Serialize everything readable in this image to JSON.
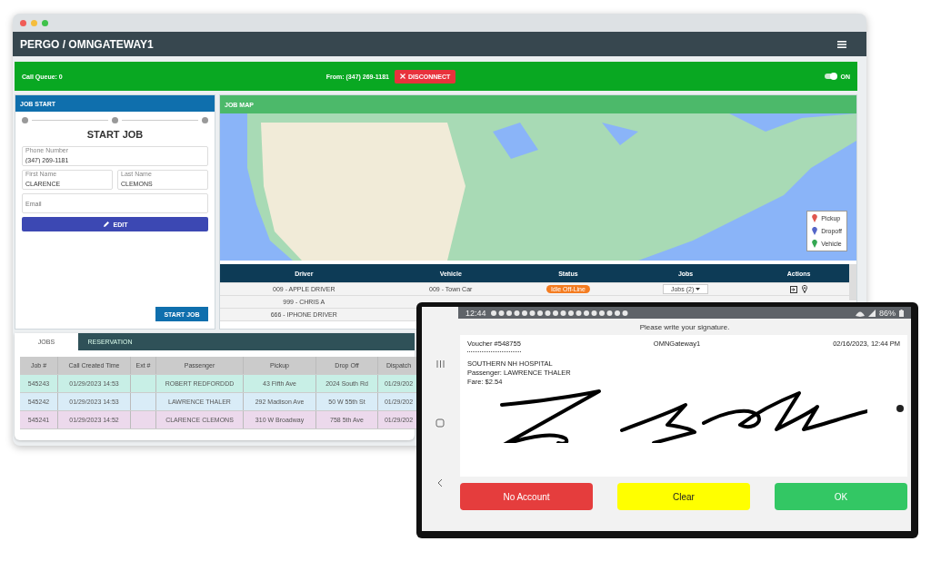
{
  "window": {
    "title": "PERGO / OMNGATEWAY1"
  },
  "call_bar": {
    "queue": "Call Queue: 0",
    "from": "From: (347) 269-1181",
    "disconnect": "DISCONNECT",
    "toggle": {
      "on": true,
      "label": "ON"
    }
  },
  "job_start": {
    "header": "JOB START",
    "title": "START JOB",
    "field_rows": [
      [
        {
          "label": "Phone Number",
          "value": "(347) 269-1181"
        }
      ],
      [
        {
          "label": "First Name",
          "value": "CLARENCE"
        },
        {
          "label": "Last Name",
          "value": "CLEMONS"
        }
      ],
      [
        {
          "placeholder": "Email"
        }
      ]
    ],
    "edit_button": "EDIT",
    "start_button": "START JOB"
  },
  "job_map": {
    "header": "JOB MAP",
    "legend": [
      {
        "label": "Pickup",
        "color": "#e0574f"
      },
      {
        "label": "Dropoff",
        "color": "#5566c8"
      },
      {
        "label": "Vehicle",
        "color": "#34a853"
      }
    ]
  },
  "drivers": {
    "columns": [
      "Driver",
      "Vehicle",
      "Status",
      "Jobs",
      "Actions"
    ],
    "rows": [
      {
        "driver": "009 - APPLE DRIVER",
        "vehicle": "009 - Town Car",
        "status": "Idle Off-Line",
        "jobs": "Jobs (2)"
      },
      {
        "driver": "999 - CHRIS A"
      },
      {
        "driver": "666 - IPHONE DRIVER"
      }
    ]
  },
  "jobs_panel": {
    "tabs": [
      {
        "label": "JOBS",
        "selected": true
      },
      {
        "label": "RESERVATION",
        "selected": false
      }
    ],
    "columns": [
      "Job #",
      "Call Created Time",
      "Ext #",
      "Passenger",
      "Pickup",
      "Drop Off",
      "Dispatch"
    ],
    "rows": [
      {
        "color": "#c8efe6",
        "cells": [
          "545243",
          "01/29/2023 14:53",
          "",
          "ROBERT REDFORDDD",
          "43 Fifth Ave",
          "2024 South Rd",
          "01/29/202"
        ]
      },
      {
        "color": "#d9ecf7",
        "cells": [
          "545242",
          "01/29/2023 14:53",
          "",
          "LAWRENCE THALER",
          "292 Madison Ave",
          "50 W 55th St",
          "01/29/202"
        ]
      },
      {
        "color": "#ecd9ec",
        "cells": [
          "545241",
          "01/29/2023 14:52",
          "",
          "CLARENCE CLEMONS",
          "310 W Broadway",
          "758 5th Ave",
          "01/29/202"
        ]
      }
    ]
  },
  "phone": {
    "time": "12:44",
    "battery": "86%",
    "prompt": "Please write your signature.",
    "voucher": "Voucher #548755",
    "gateway": "OMNGateway1",
    "datetime": "02/16/2023, 12:44 PM",
    "lines": [
      "SOUTHERN NH HOSPITAL",
      "Passenger: LAWRENCE THALER",
      "Fare: $2.54"
    ],
    "buttons": [
      {
        "kind": "danger",
        "label": "No Account"
      },
      {
        "kind": "warning",
        "label": "Clear"
      },
      {
        "kind": "confirm",
        "label": "OK"
      }
    ]
  }
}
